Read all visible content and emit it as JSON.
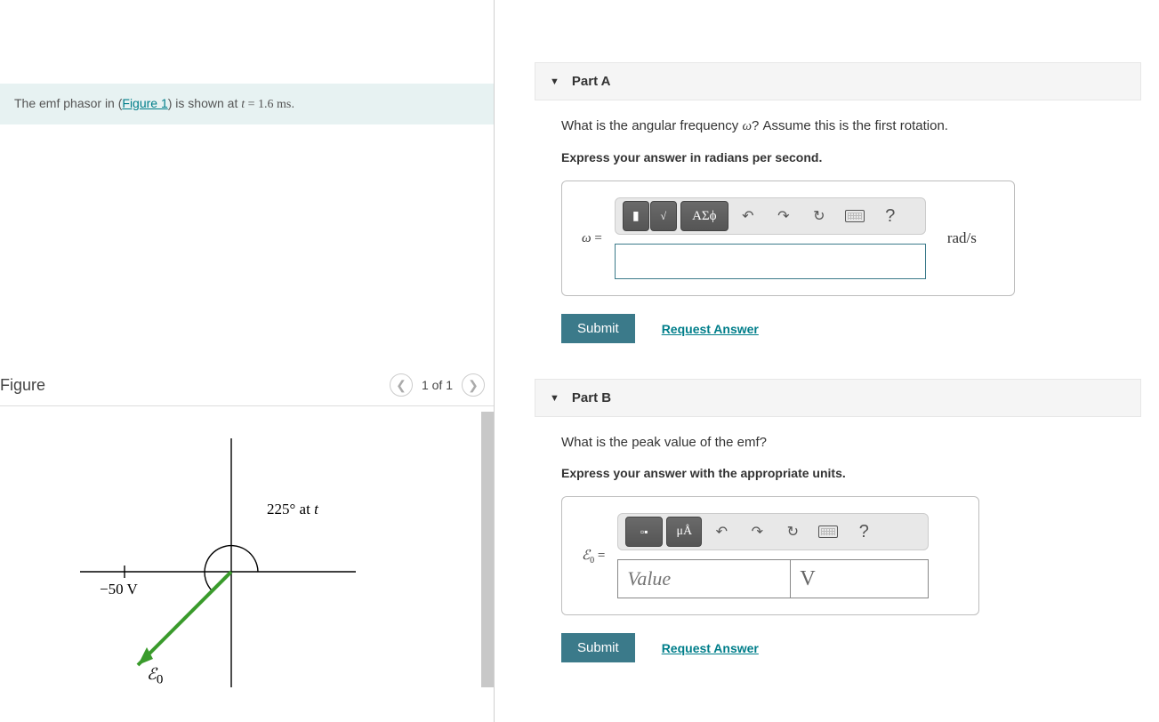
{
  "problem": {
    "prefix": "The emf phasor in (",
    "figure_link": "Figure 1",
    "mid": ") is shown at ",
    "var": "t",
    "eq": " = 1.6 ",
    "unit": "ms",
    "suffix": "."
  },
  "figure": {
    "title": "Figure",
    "counter": "1 of 1",
    "angle_label": "225° at ",
    "angle_var": "t",
    "voltage_label": "−50 V",
    "emf_symbol": "ℰ",
    "emf_sub": "0"
  },
  "partA": {
    "title": "Part A",
    "question_pre": "What is the angular frequency ",
    "omega": "ω",
    "question_post": "? Assume this is the first rotation.",
    "instruction": "Express your answer in radians per second.",
    "lhs_var": "ω",
    "lhs_eq": " =",
    "unit": "rad/s",
    "toolbar": {
      "greek": "ΑΣϕ",
      "undo": "↶",
      "redo": "↷",
      "reset": "↻",
      "help": "?"
    },
    "submit": "Submit",
    "request": "Request Answer"
  },
  "partB": {
    "title": "Part B",
    "question": "What is the peak value of the emf?",
    "instruction": "Express your answer with the appropriate units.",
    "lhs_sym": "ℰ",
    "lhs_sub": "0",
    "lhs_eq": " =",
    "value_ph": "Value",
    "unit_ph": "V",
    "toolbar": {
      "units_btn": "μÅ",
      "undo": "↶",
      "redo": "↷",
      "reset": "↻",
      "help": "?"
    },
    "submit": "Submit",
    "request": "Request Answer"
  }
}
